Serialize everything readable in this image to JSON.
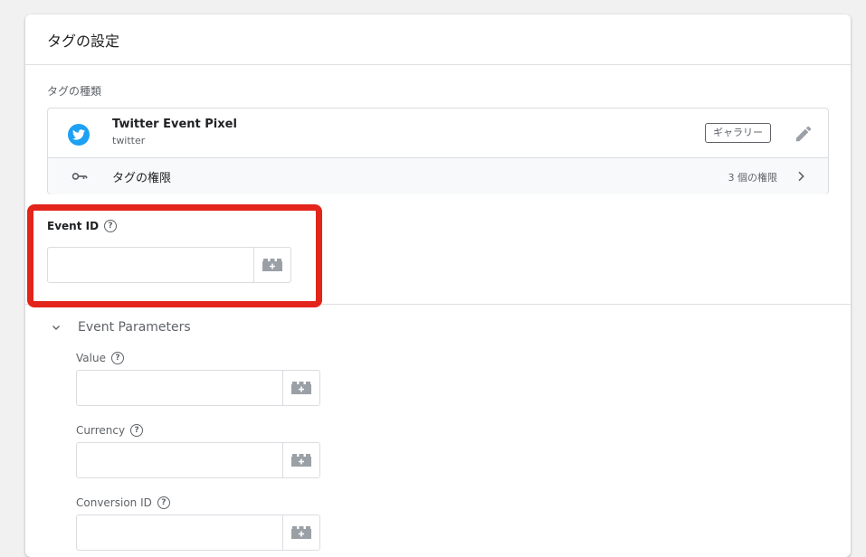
{
  "card": {
    "title": "タグの設定",
    "tag_type_label": "タグの種類"
  },
  "tag_type": {
    "name": "Twitter Event Pixel",
    "vendor": "twitter",
    "gallery_chip": "ギャラリー",
    "twitter_color": "#1da1f2"
  },
  "permissions": {
    "label": "タグの権限",
    "count_text": "3 個の権限"
  },
  "event_id": {
    "label": "Event ID",
    "value": "",
    "placeholder": ""
  },
  "event_parameters": {
    "header": "Event Parameters",
    "fields": [
      {
        "label": "Value",
        "value": ""
      },
      {
        "label": "Currency",
        "value": ""
      },
      {
        "label": "Conversion ID",
        "value": ""
      }
    ]
  },
  "colors": {
    "highlight": "#e3241b",
    "accent_text": "#5f6368"
  }
}
